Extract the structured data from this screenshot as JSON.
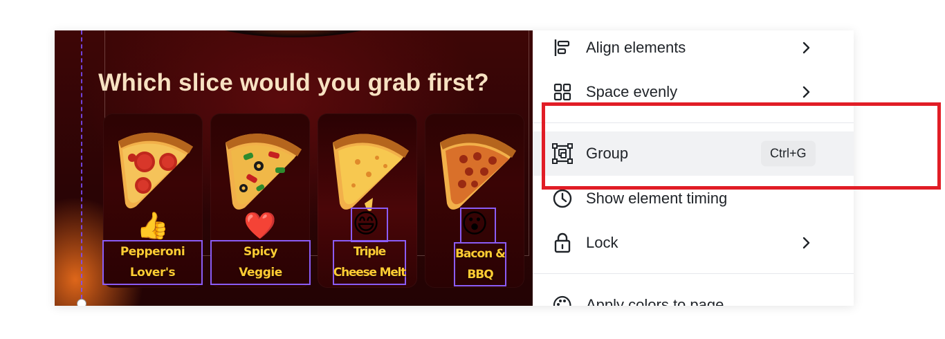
{
  "design": {
    "title": "Which slice would you grab first?",
    "cards": [
      {
        "label_lines": [
          "Pepperoni",
          "Lover's"
        ],
        "emoji": "👍",
        "icon": "thumbs-up-icon"
      },
      {
        "label_lines": [
          "Spicy",
          "Veggie"
        ],
        "emoji": "❤️",
        "icon": "heart-icon"
      },
      {
        "label_lines": [
          "Triple",
          "Cheese Melt"
        ],
        "emoji": "😄",
        "icon": "grinning-face-icon"
      },
      {
        "label_lines": [
          "Bacon &",
          "BBQ"
        ],
        "emoji": "😮",
        "icon": "surprised-face-icon"
      }
    ]
  },
  "menu": {
    "items": [
      {
        "label": "Align elements",
        "icon": "align-elements-icon",
        "submenu": true
      },
      {
        "label": "Space evenly",
        "icon": "space-evenly-icon",
        "submenu": true
      },
      {
        "label": "Group",
        "icon": "group-icon",
        "shortcut": "Ctrl+G",
        "highlighted": true
      },
      {
        "label": "Show element timing",
        "icon": "timer-icon"
      },
      {
        "label": "Lock",
        "icon": "lock-icon",
        "submenu": true
      },
      {
        "label": "Apply colors to page",
        "icon": "palette-icon"
      }
    ]
  },
  "colors": {
    "annotation": "#e11d26",
    "selection": "#8b5cf6",
    "label_text": "#ffcc33",
    "title_text": "#f7e2c2"
  }
}
